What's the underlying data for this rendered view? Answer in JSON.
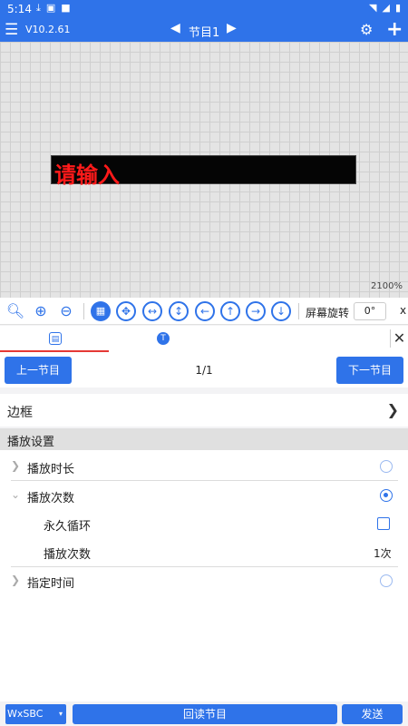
{
  "statusbar": {
    "time": "5:14"
  },
  "appbar": {
    "version": "V10.2.61",
    "program_title": "节目1"
  },
  "canvas": {
    "led_text": "请输入",
    "zoom": "2100%",
    "led_color": "#ff1a1a"
  },
  "toolbar": {
    "rotate_label": "屏幕旋转",
    "rotate_value": "0°",
    "x_label": "x"
  },
  "nav": {
    "prev_label": "上一节目",
    "page": "1/1",
    "next_label": "下一节目"
  },
  "border_row": {
    "label": "边框"
  },
  "playback": {
    "header": "播放设置",
    "duration_label": "播放时长",
    "count_label": "播放次数",
    "loop_label": "永久循环",
    "count_sub_label": "播放次数",
    "count_value": "1次",
    "schedule_label": "指定时间"
  },
  "bottom": {
    "device": "WxSBC",
    "read_label": "回读节目",
    "send_label": "发送"
  },
  "colors": {
    "accent": "#2f73e9"
  }
}
